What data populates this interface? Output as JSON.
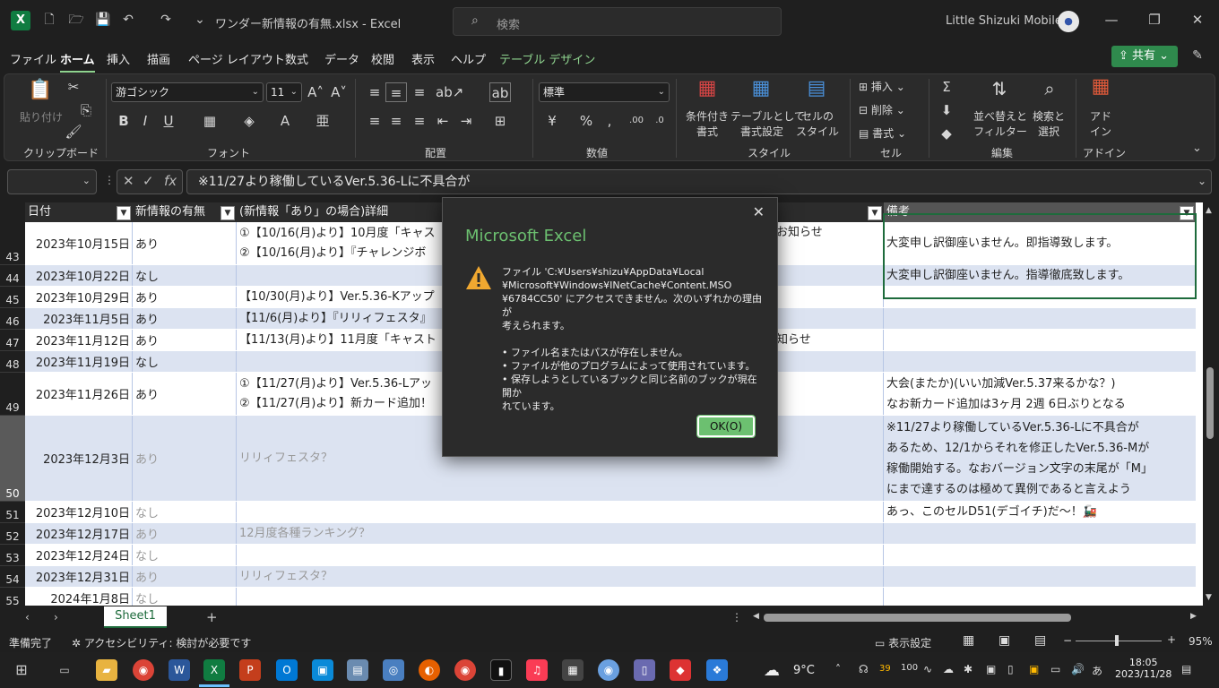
{
  "titlebar": {
    "doc_title": "ワンダー新情報の有無.xlsx - Excel",
    "search_placeholder": "検索",
    "user_name": "Little Shizuki Mobile"
  },
  "menu": [
    "ファイル",
    "ホーム",
    "挿入",
    "描画",
    "ページ レイアウト",
    "数式",
    "データ",
    "校閲",
    "表示",
    "ヘルプ",
    "テーブル デザイン"
  ],
  "share_label": "共有",
  "ribbon": {
    "clipboard": {
      "paste": "貼り付け",
      "label": "クリップボード"
    },
    "font": {
      "name": "游ゴシック",
      "size": "11",
      "label": "フォント"
    },
    "alignment": {
      "label": "配置"
    },
    "number": {
      "format": "標準",
      "label": "数値"
    },
    "styles": {
      "cond_fmt": "条件付き",
      "cond_fmt2": "書式",
      "as_table": "テーブルとして",
      "as_table2": "書式設定",
      "cell_style": "セルの",
      "cell_style2": "スタイル",
      "label": "スタイル"
    },
    "cells": {
      "insert": "挿入",
      "delete": "削除",
      "format": "書式",
      "label": "セル"
    },
    "editing": {
      "sort": "並べ替えと",
      "sort2": "フィルター",
      "find": "検索と",
      "find2": "選択",
      "label": "編集"
    },
    "addins": {
      "addin": "アド",
      "addin2": "イン",
      "label": "アドイン"
    }
  },
  "formula": {
    "content": "※11/27より稼働しているVer.5.36-Lに不具合が"
  },
  "headers": {
    "date": "日付",
    "flag": "新情報の有無",
    "detail": "(新情報「あり」の場合)詳細",
    "note": "備考"
  },
  "rows": [
    {
      "num": "43",
      "date": "2023年10月15日",
      "flag": "あり",
      "detail1": "①【10/16(月)より】10月度「キャス",
      "detail1b": "お知らせ",
      "detail2": "②【10/16(月)より】『チャレンジボ",
      "note1": "大変申し訳御座いません。即指導致します。",
      "note2": ""
    },
    {
      "num": "44",
      "date": "2023年10月22日",
      "flag": "なし",
      "detail1": "",
      "detail2": "",
      "note1": "大変申し訳御座いません。指導徹底致します。",
      "note2": ""
    },
    {
      "num": "45",
      "date": "2023年10月29日",
      "flag": "あり",
      "detail1": "【10/30(月)より】Ver.5.36-Kアップ",
      "detail2": "",
      "note1": "",
      "note2": ""
    },
    {
      "num": "46",
      "date": "2023年11月5日",
      "flag": "あり",
      "detail1": "【11/6(月)より】『リリィフェスタ』",
      "detail2": "",
      "note1": "",
      "note2": ""
    },
    {
      "num": "47",
      "date": "2023年11月12日",
      "flag": "あり",
      "detail1": "【11/13(月)より】11月度「キャスト",
      "detail1b": "知らせ",
      "detail2": "",
      "note1": "",
      "note2": ""
    },
    {
      "num": "48",
      "date": "2023年11月19日",
      "flag": "なし",
      "detail1": "",
      "detail2": "",
      "note1": "",
      "note2": ""
    },
    {
      "num": "49",
      "date": "2023年11月26日",
      "flag": "あり",
      "detail1": "①【11/27(月)より】Ver.5.36-Lアッ",
      "detail2": "②【11/27(月)より】新カード追加！",
      "note1": "大会(またか)(いい加減Ver.5.37来るかな？)",
      "note2": "なお新カード追加は3ヶ月 2週 6日ぶりとなる"
    },
    {
      "num": "50",
      "date": "2023年12月3日",
      "flag": "あり",
      "detail1": "リリィフェスタ？",
      "detail2": "",
      "note1": "※11/27より稼働しているVer.5.36-Lに不具合が",
      "note2": "あるため、12/1からそれを修正したVer.5.36-Mが",
      "note3": "稼働開始する。なおバージョン文字の末尾が「M」",
      "note4": "にまで達するのは極めて異例であると言えよう"
    },
    {
      "num": "51",
      "date": "2023年12月10日",
      "flag": "なし",
      "detail1": "",
      "detail2": "",
      "note1": "あっ、このセルD51(デゴイチ)だ〜！🚂",
      "note2": ""
    },
    {
      "num": "52",
      "date": "2023年12月17日",
      "flag": "あり",
      "detail1": "12月度各種ランキング？",
      "detail2": "",
      "note1": "",
      "note2": ""
    },
    {
      "num": "53",
      "date": "2023年12月24日",
      "flag": "なし",
      "detail1": "",
      "detail2": "",
      "note1": "",
      "note2": ""
    },
    {
      "num": "54",
      "date": "2023年12月31日",
      "flag": "あり",
      "detail1": "リリィフェスタ？",
      "detail2": "",
      "note1": "",
      "note2": ""
    },
    {
      "num": "55",
      "date": "2024年1月8日",
      "flag": "なし",
      "detail1": "",
      "detail2": "",
      "note1": "",
      "note2": ""
    }
  ],
  "sheet_tab": "Sheet1",
  "status": {
    "ready": "準備完了",
    "accessibility": "アクセシビリティ: 検討が必要です",
    "display_settings": "表示設定",
    "zoom": "95%"
  },
  "dialog": {
    "title": "Microsoft Excel",
    "msg_line1": "ファイル 'C:¥Users¥shizu¥AppData¥Local",
    "msg_line2": "¥Microsoft¥Windows¥INetCache¥Content.MSO",
    "msg_line3": "¥6784CC50' にアクセスできません。次のいずれかの理由が",
    "msg_line4": "考えられます。",
    "bullet1": "• ファイル名またはパスが存在しません。",
    "bullet2": "• ファイルが他のプログラムによって使用されています。",
    "bullet3": "• 保存しようとしているブックと同じ名前のブックが現在開か",
    "bullet3b": "れています。",
    "ok": "OK(O)"
  },
  "taskbar": {
    "weather": "9°C",
    "time": "18:05",
    "date": "2023/11/28",
    "badge": "39"
  }
}
